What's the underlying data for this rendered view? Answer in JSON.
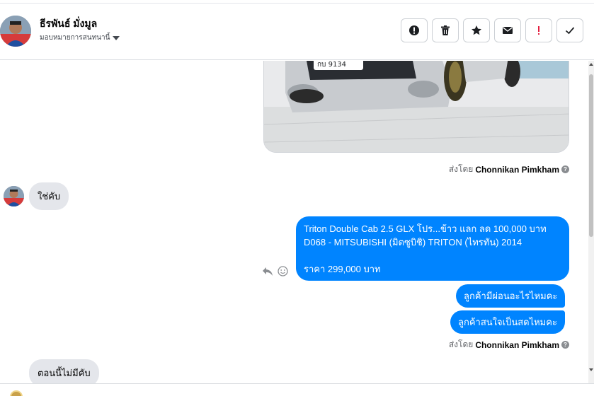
{
  "header": {
    "user_name": "ธีรพันธ์ มั่งมูล",
    "assign_label": "มอบหมายการสนทนานี้",
    "actions": [
      {
        "icon": "alert-circle-icon",
        "name": "mark-alert-button"
      },
      {
        "icon": "trash-icon",
        "name": "delete-button"
      },
      {
        "icon": "star-icon",
        "name": "star-button"
      },
      {
        "icon": "envelope-icon",
        "name": "mark-unread-button"
      },
      {
        "icon": "exclamation-icon",
        "name": "mark-spam-button"
      },
      {
        "icon": "check-icon",
        "name": "mark-done-button"
      }
    ]
  },
  "messages": {
    "sent_by_prefix": "ส่งโดย",
    "sent_by_name": "Chonnikan Pimkham",
    "reply_1": "ใช่คับ",
    "listing_title": "Triton Double Cab 2.5 GLX โปร...ข้าว แลก ลด 100,000 บาท",
    "listing_subtitle": "D068 - MITSUBISHI (มิตซูบิชิ) TRITON (ไทรทัน) 2014",
    "listing_price": "ราคา 299,000 บาท",
    "out_1": "ลูกค้ามีผ่อนอะไรไหมคะ",
    "out_2": "ลูกค้าสนใจเป็นสดไหมคะ",
    "reply_2": "ตอนนี้ไม่มีคับ",
    "plate_text": "กบ 9134"
  },
  "colors": {
    "accent": "#0084ff",
    "bubble_in": "#e4e6eb",
    "alert_red": "#e41e3f"
  }
}
